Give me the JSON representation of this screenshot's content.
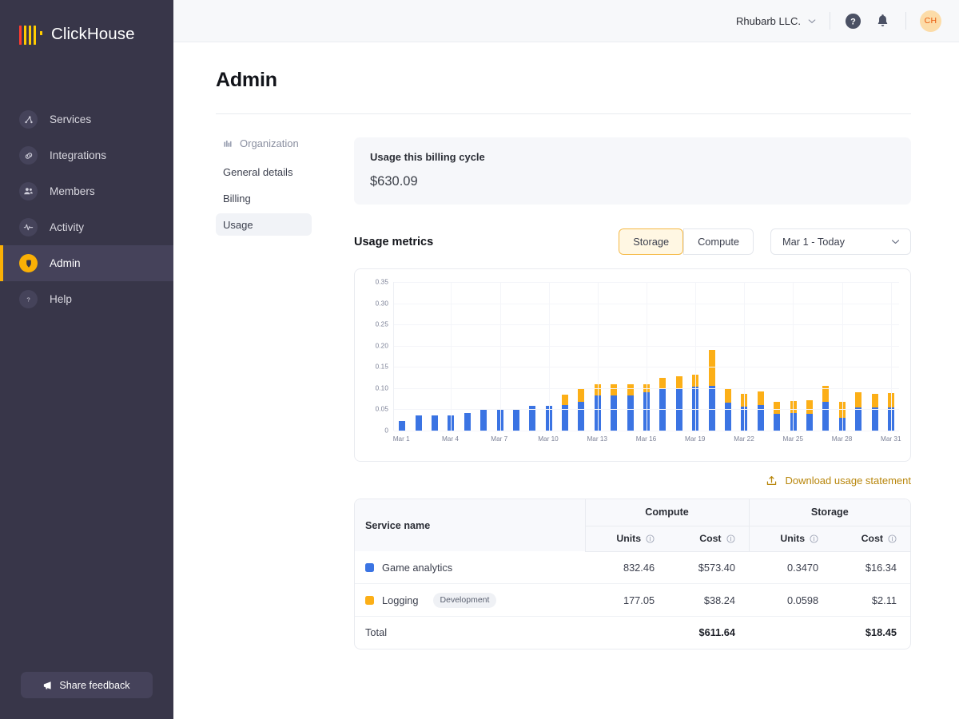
{
  "brand": {
    "name": "ClickHouse",
    "logo_icon": "clickhouse-logo-icon"
  },
  "sidebar": {
    "items": [
      {
        "label": "Services",
        "icon": "services-icon",
        "active": false
      },
      {
        "label": "Integrations",
        "icon": "integrations-link-icon",
        "active": false
      },
      {
        "label": "Members",
        "icon": "members-people-icon",
        "active": false
      },
      {
        "label": "Activity",
        "icon": "activity-pulse-icon",
        "active": false
      },
      {
        "label": "Admin",
        "icon": "admin-shield-icon",
        "active": true
      },
      {
        "label": "Help",
        "icon": "help-question-icon",
        "active": false
      }
    ],
    "feedback_label": "Share feedback",
    "feedback_icon": "megaphone-icon"
  },
  "topbar": {
    "org_name": "Rhubarb LLC.",
    "org_chevron_icon": "chevron-down-icon",
    "help_icon": "help-circle-icon",
    "notifications_icon": "bell-icon",
    "avatar_initials": "CH"
  },
  "page": {
    "title": "Admin"
  },
  "subnav": {
    "section_label": "Organization",
    "section_icon": "organization-building-icon",
    "items": [
      {
        "label": "General details",
        "active": false
      },
      {
        "label": "Billing",
        "active": false
      },
      {
        "label": "Usage",
        "active": true
      }
    ]
  },
  "usage_card": {
    "label": "Usage this billing cycle",
    "value": "$630.09"
  },
  "metrics": {
    "title": "Usage metrics",
    "toggle": [
      {
        "label": "Storage",
        "active": true
      },
      {
        "label": "Compute",
        "active": false
      }
    ],
    "date_range": "Mar 1 - Today",
    "date_chevron_icon": "chevron-down-icon"
  },
  "download": {
    "label": "Download usage statement",
    "icon": "download-export-icon"
  },
  "chart_data": {
    "type": "bar",
    "stacked": true,
    "title": "",
    "xlabel": "",
    "ylabel": "",
    "ylim": [
      0,
      0.35
    ],
    "yticks": [
      0,
      0.05,
      0.1,
      0.15,
      0.2,
      0.25,
      0.3,
      0.35
    ],
    "ytick_labels": [
      "0",
      "0.05",
      "0.10",
      "0.15",
      "0.20",
      "0.25",
      "0.30",
      "0.35"
    ],
    "grid": true,
    "legend_position": "none",
    "categories": [
      "Mar 1",
      "Mar 2",
      "Mar 3",
      "Mar 4",
      "Mar 5",
      "Mar 6",
      "Mar 7",
      "Mar 8",
      "Mar 9",
      "Mar 10",
      "Mar 11",
      "Mar 12",
      "Mar 13",
      "Mar 14",
      "Mar 15",
      "Mar 16",
      "Mar 17",
      "Mar 18",
      "Mar 19",
      "Mar 20",
      "Mar 21",
      "Mar 22",
      "Mar 23",
      "Mar 24",
      "Mar 25",
      "Mar 26",
      "Mar 27",
      "Mar 28",
      "Mar 29",
      "Mar 30",
      "Mar 31"
    ],
    "xtick_labels": [
      "Mar 1",
      "Mar 4",
      "Mar 7",
      "Mar 10",
      "Mar 13",
      "Mar 16",
      "Mar 19",
      "Mar 22",
      "Mar 25",
      "Mar 28",
      "Mar 31"
    ],
    "xtick_indices": [
      0,
      3,
      6,
      9,
      12,
      15,
      18,
      21,
      24,
      27,
      30
    ],
    "series": [
      {
        "name": "Game analytics",
        "color": "#3B74E3",
        "values": [
          0.022,
          0.035,
          0.035,
          0.035,
          0.042,
          0.049,
          0.049,
          0.049,
          0.059,
          0.059,
          0.06,
          0.068,
          0.082,
          0.082,
          0.082,
          0.09,
          0.098,
          0.098,
          0.103,
          0.105,
          0.066,
          0.057,
          0.06,
          0.04,
          0.041,
          0.04,
          0.068,
          0.031,
          0.055,
          0.055,
          0.055
        ]
      },
      {
        "name": "Logging",
        "color": "#FCAF17",
        "values": [
          0.0,
          0.0,
          0.0,
          0.0,
          0.0,
          0.0,
          0.0,
          0.0,
          0.0,
          0.0,
          0.025,
          0.03,
          0.028,
          0.028,
          0.028,
          0.02,
          0.027,
          0.03,
          0.028,
          0.085,
          0.031,
          0.03,
          0.033,
          0.027,
          0.028,
          0.031,
          0.038,
          0.036,
          0.035,
          0.031,
          0.034
        ]
      }
    ]
  },
  "table": {
    "service_col_header": "Service name",
    "groups": [
      {
        "label": "Compute"
      },
      {
        "label": "Storage"
      }
    ],
    "sub_headers": [
      "Units",
      "Cost",
      "Units",
      "Cost"
    ],
    "info_icon": "info-circle-icon",
    "rows": [
      {
        "name": "Game analytics",
        "color": "#3B74E3",
        "badge": "",
        "compute_units": "832.46",
        "compute_cost": "$573.40",
        "storage_units": "0.3470",
        "storage_cost": "$16.34"
      },
      {
        "name": "Logging",
        "color": "#FCAF17",
        "badge": "Development",
        "compute_units": "177.05",
        "compute_cost": "$38.24",
        "storage_units": "0.0598",
        "storage_cost": "$2.11"
      }
    ],
    "total": {
      "label": "Total",
      "compute_units": "",
      "compute_cost": "$611.64",
      "storage_units": "",
      "storage_cost": "$18.45"
    }
  },
  "colors": {
    "sidebar_bg": "#383649",
    "sidebar_active": "#45425A",
    "accent_yellow": "#FAB005",
    "series_blue": "#3B74E3",
    "series_orange": "#FCAF17",
    "link_gold": "#B8860B"
  }
}
